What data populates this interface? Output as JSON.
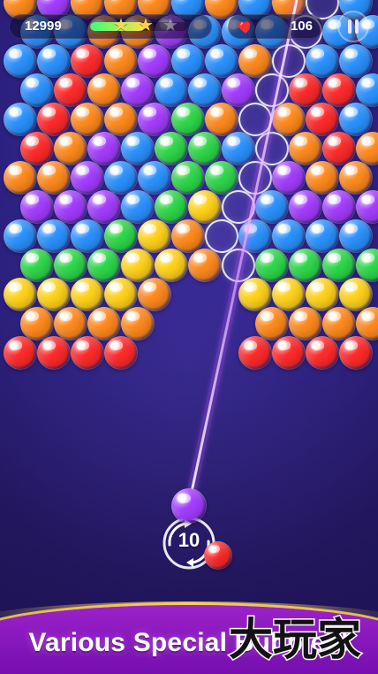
{
  "hud": {
    "score": "12999",
    "moves": "106",
    "stars_earned": 2,
    "stars_total": 3,
    "score_progress": 0.55
  },
  "board": {
    "rows": [
      [
        "orange",
        "purple",
        "orange",
        "orange",
        "orange",
        "blue",
        "orange",
        "blue",
        "orange",
        "blue",
        "blue"
      ],
      [
        "blue",
        "blue",
        "orange",
        "orange",
        "purple",
        "blue",
        "blue",
        "blue",
        "orange",
        "blue",
        "blue"
      ],
      [
        "blue",
        "blue",
        "red",
        "orange",
        "purple",
        "blue",
        "blue",
        "orange",
        "red",
        "blue",
        "blue"
      ],
      [
        "blue",
        "red",
        "orange",
        "purple",
        "blue",
        "blue",
        "purple",
        "purple",
        "red",
        "red",
        "blue"
      ],
      [
        "blue",
        "red",
        "orange",
        "orange",
        "purple",
        "green",
        "orange",
        "purple",
        "orange",
        "red",
        "blue"
      ],
      [
        "red",
        "orange",
        "purple",
        "blue",
        "green",
        "green",
        "blue",
        "purple",
        "orange",
        "red",
        "orange"
      ],
      [
        "orange",
        "orange",
        "purple",
        "blue",
        "blue",
        "green",
        "green",
        "blue",
        "purple",
        "orange",
        "orange"
      ],
      [
        "purple",
        "purple",
        "purple",
        "blue",
        "green",
        "yellow",
        "green",
        "blue",
        "purple",
        "purple",
        "purple"
      ],
      [
        "blue",
        "blue",
        "blue",
        "green",
        "yellow",
        "orange",
        "orange",
        "blue",
        "blue",
        "blue",
        "blue"
      ],
      [
        "green",
        "green",
        "green",
        "yellow",
        "yellow",
        "orange",
        "orange",
        "green",
        "green",
        "green",
        "green"
      ],
      [
        "yellow",
        "yellow",
        "yellow",
        "yellow",
        "orange",
        "",
        "",
        "yellow",
        "yellow",
        "yellow",
        "yellow"
      ],
      [
        "orange",
        "orange",
        "orange",
        "orange",
        "",
        "",
        "",
        "orange",
        "orange",
        "orange",
        "orange"
      ],
      [
        "red",
        "red",
        "red",
        "red",
        "",
        "",
        "",
        "red",
        "red",
        "red",
        "red"
      ]
    ],
    "highlighted": [
      [
        0,
        9
      ],
      [
        1,
        8
      ],
      [
        2,
        8
      ],
      [
        3,
        7
      ],
      [
        4,
        7
      ],
      [
        5,
        7
      ],
      [
        6,
        7
      ],
      [
        7,
        6
      ],
      [
        8,
        6
      ],
      [
        9,
        6
      ],
      [
        10,
        6
      ],
      [
        11,
        6
      ],
      [
        12,
        6
      ]
    ]
  },
  "shooter": {
    "shots_left": "10",
    "current_color": "purple",
    "next_color": "red"
  },
  "banner": {
    "text": "Various Special Bubbles!"
  },
  "watermark": {
    "text": "大玩家"
  },
  "colors": {
    "red": "#ff2b2b",
    "orange": "#ff8a1d",
    "yellow": "#ffd31a",
    "green": "#2ed84a",
    "blue": "#2b92ff",
    "purple": "#a43dff",
    "beam": "#c05bff",
    "banner": "#8b18c4"
  },
  "icons": {
    "heart": "heart-icon",
    "pause": "pause-icon",
    "star": "star-icon",
    "swap": "swap-icon"
  }
}
